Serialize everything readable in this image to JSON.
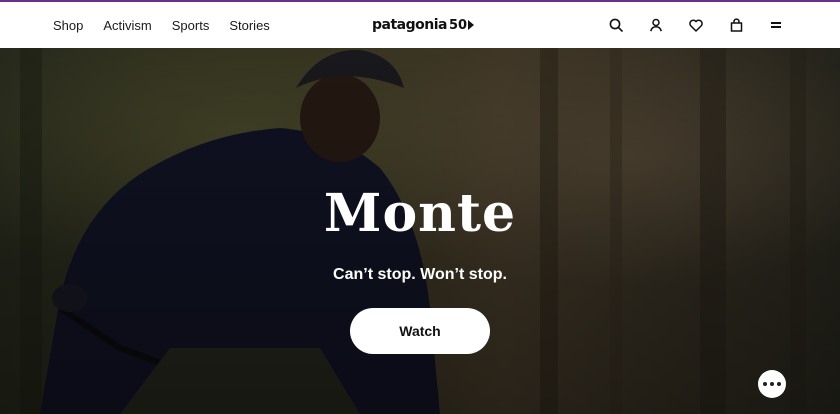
{
  "nav": {
    "links": [
      "Shop",
      "Activism",
      "Sports",
      "Stories"
    ],
    "logo_word": "patagonia",
    "logo_num": "50",
    "icons": [
      "search-icon",
      "account-icon",
      "wishlist-icon",
      "cart-icon",
      "menu-icon"
    ]
  },
  "hero": {
    "title": "Monte",
    "subtitle": "Can’t stop. Won’t stop.",
    "cta_label": "Watch"
  },
  "colors": {
    "accent_line": "#6a2f8a",
    "nav_bg": "#ffffff",
    "hero_text": "#ffffff"
  }
}
